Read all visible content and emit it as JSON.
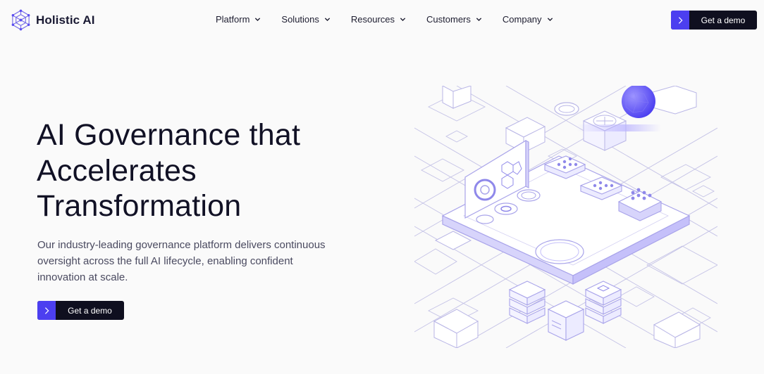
{
  "brand": {
    "name": "Holistic AI"
  },
  "nav": {
    "items": [
      {
        "label": "Platform"
      },
      {
        "label": "Solutions"
      },
      {
        "label": "Resources"
      },
      {
        "label": "Customers"
      },
      {
        "label": "Company"
      }
    ],
    "cta_label": "Get a demo"
  },
  "hero": {
    "title_lines": [
      "AI Governance that",
      "Accelerates",
      "Transformation"
    ],
    "subtitle": "Our industry-leading governance platform delivers continuous oversight across the full AI lifecycle, enabling confident innovation at scale.",
    "cta_label": "Get a demo"
  },
  "colors": {
    "accent": "#4c3ff0",
    "button_dark": "#0f0f1f",
    "illustration_line": "#b9b6e6",
    "illustration_fill": "#d7d4fb",
    "sphere": "#6a5cf2"
  },
  "icons": {
    "logo": "hexagon-network-icon",
    "nav_chevron": "chevron-down-icon",
    "cta_arrow": "chevron-right-icon"
  }
}
